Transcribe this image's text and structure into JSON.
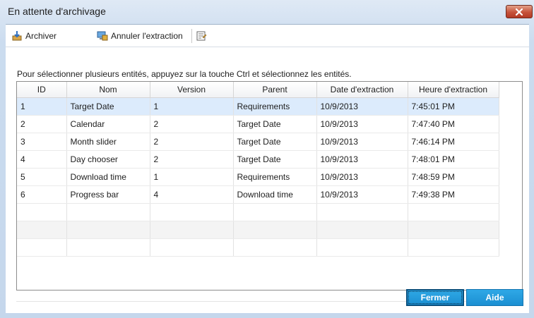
{
  "window": {
    "title": "En attente d'archivage"
  },
  "toolbar": {
    "archive_label": "Archiver",
    "undo_checkout_label": "Annuler l'extraction"
  },
  "instruction": "Pour sélectionner plusieurs entités, appuyez sur la touche Ctrl et sélectionnez les entités.",
  "table": {
    "columns": [
      "ID",
      "Nom",
      "Version",
      "Parent",
      "Date d'extraction",
      "Heure d'extraction"
    ],
    "rows": [
      [
        "1",
        "Target Date",
        "1",
        "Requirements",
        "10/9/2013",
        "7:45:01 PM"
      ],
      [
        "2",
        "Calendar",
        "2",
        "Target Date",
        "10/9/2013",
        "7:47:40 PM"
      ],
      [
        "3",
        "Month slider",
        "2",
        "Target Date",
        "10/9/2013",
        "7:46:14 PM"
      ],
      [
        "4",
        "Day chooser",
        "2",
        "Target Date",
        "10/9/2013",
        "7:48:01 PM"
      ],
      [
        "5",
        "Download time",
        "1",
        "Requirements",
        "10/9/2013",
        "7:48:59 PM"
      ],
      [
        "6",
        "Progress bar",
        "4",
        "Download time",
        "10/9/2013",
        "7:49:38 PM"
      ]
    ],
    "selected_row": 0
  },
  "buttons": {
    "close_label": "Fermer",
    "help_label": "Aide"
  },
  "colors": {
    "accent": "#1b8fd2",
    "selection": "#dcebfc",
    "close_button": "#c6533b"
  }
}
